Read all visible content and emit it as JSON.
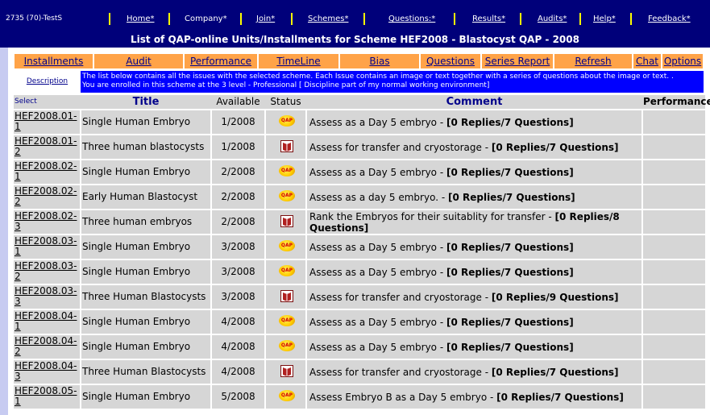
{
  "user": "2735 (70)-TestS",
  "nav": [
    "Home*",
    "Company*",
    "Join*",
    "Schemes*",
    "Questions:*",
    "Results*",
    "Audits*",
    "Help*",
    "Feedback*"
  ],
  "page_title": "List of  QAP-online Units/Installments for Scheme HEF2008 - Blastocyst QAP - 2008",
  "menu": [
    "Installments",
    "Audit",
    "Performance",
    "TimeLine",
    "Bias",
    "Questions",
    "Series Report",
    "Refresh",
    "Chat",
    "Options"
  ],
  "description": {
    "link": "Description",
    "line1": "The list below contains all the issues with the selected scheme. Each Issue contains an image or text together with a series of questions about the image or text. .",
    "line2": "You are enrolled in this scheme at the 3 level - Professional [ Discipline part of my normal working environment]"
  },
  "table": {
    "headers": [
      "Select",
      "Title",
      "Available",
      "Status",
      "Comment",
      "Performance"
    ],
    "rows": [
      {
        "id": "HEF2008.01-1",
        "title": "Single Human Embryo",
        "available": "1/2008",
        "status": "qap-icon",
        "comment": "Assess as a Day 5 embryo - ",
        "replies": "[0 Replies/7 Questions]"
      },
      {
        "id": "HEF2008.01-2",
        "title": "Three human blastocysts",
        "available": "1/2008",
        "status": "book-icon",
        "comment": "Assess for transfer and cryostorage - ",
        "replies": "[0 Replies/7 Questions]"
      },
      {
        "id": "HEF2008.02-1",
        "title": "Single Human Embryo",
        "available": "2/2008",
        "status": "qap-icon",
        "comment": "Assess as a Day 5 embryo - ",
        "replies": "[0 Replies/7 Questions]"
      },
      {
        "id": "HEF2008.02-2",
        "title": "Early Human Blastocyst",
        "available": "2/2008",
        "status": "qap-icon",
        "comment": "Assess as a day 5 embryo. - ",
        "replies": "[0 Replies/7 Questions]"
      },
      {
        "id": "HEF2008.02-3",
        "title": "Three human embryos",
        "available": "2/2008",
        "status": "book-icon",
        "comment": "Rank the Embryos for their suitablity for transfer - ",
        "replies": "[0 Replies/8 Questions]"
      },
      {
        "id": "HEF2008.03-1",
        "title": "Single Human Embryo",
        "available": "3/2008",
        "status": "qap-icon",
        "comment": "Assess as a Day 5 embryo - ",
        "replies": "[0 Replies/7 Questions]"
      },
      {
        "id": "HEF2008.03-2",
        "title": "Single Human Embryo",
        "available": "3/2008",
        "status": "qap-icon",
        "comment": "Assess as a Day 5 embryo - ",
        "replies": "[0 Replies/7 Questions]"
      },
      {
        "id": "HEF2008.03-3",
        "title": "Three Human Blastocysts",
        "available": "3/2008",
        "status": "book-icon",
        "comment": "Assess for transfer and cryostorage - ",
        "replies": "[0 Replies/9 Questions]"
      },
      {
        "id": "HEF2008.04-1",
        "title": "Single Human Embryo",
        "available": "4/2008",
        "status": "qap-icon",
        "comment": "Assess as a Day 5 embryo - ",
        "replies": "[0 Replies/7 Questions]"
      },
      {
        "id": "HEF2008.04-2",
        "title": "Single Human Embryo",
        "available": "4/2008",
        "status": "qap-icon",
        "comment": "Assess as a Day 5 embryo - ",
        "replies": "[0 Replies/7 Questions]"
      },
      {
        "id": "HEF2008.04-3",
        "title": "Three Human Blastocysts",
        "available": "4/2008",
        "status": "book-icon",
        "comment": "Assess for transfer and cryostorage - ",
        "replies": "[0 Replies/7 Questions]"
      },
      {
        "id": "HEF2008.05-1",
        "title": "Single Human Embryo",
        "available": "5/2008",
        "status": "qap-icon",
        "comment": "Assess Embryo B as a Day 5 embryo - ",
        "replies": "[0 Replies/7 Questions]"
      }
    ]
  },
  "icon_text": {
    "qap": "QAP"
  },
  "colors": {
    "nav_bg": "#00007a",
    "menu_bg": "#ffa348",
    "desc_bg": "#0000ff",
    "cell_bg": "#d6d6d6",
    "separator": "#ffff00"
  }
}
